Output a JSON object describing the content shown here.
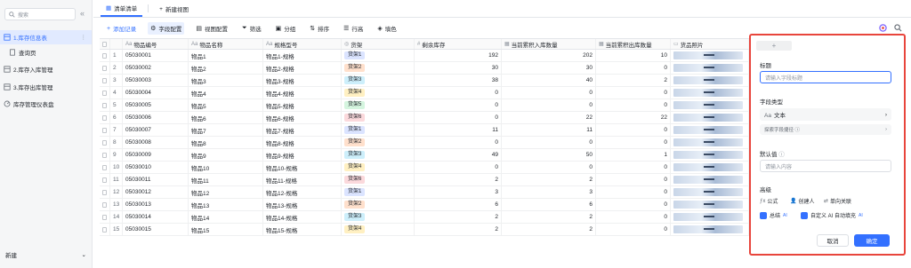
{
  "sidebar": {
    "search_placeholder": "搜索",
    "items": [
      {
        "label": "1.库存信息表"
      },
      {
        "label": "查询页"
      },
      {
        "label": "2.库存入库管理"
      },
      {
        "label": "3.库存出库管理"
      },
      {
        "label": "库存管理仪表盘"
      }
    ],
    "footer_label": "新建"
  },
  "tabs": [
    {
      "label": "清单清单"
    },
    {
      "label": "新建视图"
    }
  ],
  "toolbar": {
    "add": "添加记录",
    "field_config": "字段配置",
    "view_config": "视图配置",
    "filter": "筛选",
    "group": "分组",
    "sort": "排序",
    "row_height": "行高",
    "color": "填色"
  },
  "table": {
    "headers": [
      "物品编号",
      "物品名称",
      "规格型号",
      "货架",
      "剩余库存",
      "当前累积入库数量",
      "当前累积出库数量",
      "货品照片"
    ],
    "header_icons": [
      "Aa",
      "Aa",
      "Aa",
      "◎",
      "#",
      "▦",
      "▦",
      "▭"
    ],
    "rows": [
      {
        "idx": "1",
        "code": "05030001",
        "name": "物品1",
        "spec": "物品1-规格",
        "shelf": "货架1",
        "stock": "192",
        "in": "202",
        "out": "10"
      },
      {
        "idx": "2",
        "code": "05030002",
        "name": "物品2",
        "spec": "物品2-规格",
        "shelf": "货架2",
        "stock": "30",
        "in": "30",
        "out": "0"
      },
      {
        "idx": "3",
        "code": "05030003",
        "name": "物品3",
        "spec": "物品3-规格",
        "shelf": "货架3",
        "stock": "38",
        "in": "40",
        "out": "2"
      },
      {
        "idx": "4",
        "code": "05030004",
        "name": "物品4",
        "spec": "物品4-规格",
        "shelf": "货架4",
        "stock": "0",
        "in": "0",
        "out": "0"
      },
      {
        "idx": "5",
        "code": "05030005",
        "name": "物品5",
        "spec": "物品5-规格",
        "shelf": "货架5",
        "stock": "0",
        "in": "0",
        "out": "0"
      },
      {
        "idx": "6",
        "code": "05030006",
        "name": "物品6",
        "spec": "物品6-规格",
        "shelf": "货架6",
        "stock": "0",
        "in": "22",
        "out": "22"
      },
      {
        "idx": "7",
        "code": "05030007",
        "name": "物品7",
        "spec": "物品7-规格",
        "shelf": "货架1",
        "stock": "11",
        "in": "11",
        "out": "0"
      },
      {
        "idx": "8",
        "code": "05030008",
        "name": "物品8",
        "spec": "物品8-规格",
        "shelf": "货架2",
        "stock": "0",
        "in": "0",
        "out": "0"
      },
      {
        "idx": "9",
        "code": "05030009",
        "name": "物品9",
        "spec": "物品9-规格",
        "shelf": "货架3",
        "stock": "49",
        "in": "50",
        "out": "1"
      },
      {
        "idx": "10",
        "code": "05030010",
        "name": "物品10",
        "spec": "物品10-规格",
        "shelf": "货架4",
        "stock": "0",
        "in": "0",
        "out": "0"
      },
      {
        "idx": "11",
        "code": "05030011",
        "name": "物品11",
        "spec": "物品11-规格",
        "shelf": "货架6",
        "stock": "2",
        "in": "2",
        "out": "0"
      },
      {
        "idx": "12",
        "code": "05030012",
        "name": "物品12",
        "spec": "物品12-规格",
        "shelf": "货架1",
        "stock": "3",
        "in": "3",
        "out": "0"
      },
      {
        "idx": "13",
        "code": "05030013",
        "name": "物品13",
        "spec": "物品13-规格",
        "shelf": "货架2",
        "stock": "6",
        "in": "6",
        "out": "0"
      },
      {
        "idx": "14",
        "code": "05030014",
        "name": "物品14",
        "spec": "物品14-规格",
        "shelf": "货架3",
        "stock": "2",
        "in": "2",
        "out": "0"
      },
      {
        "idx": "15",
        "code": "05030015",
        "name": "物品15",
        "spec": "物品15-规格",
        "shelf": "货架4",
        "stock": "2",
        "in": "2",
        "out": "0"
      }
    ]
  },
  "shelf_colors": {
    "货架1": "#dbe4ff",
    "货架2": "#ffe0cc",
    "货架3": "#cdeffb",
    "货架4": "#fff0c2",
    "货架5": "#d5f5df",
    "货架6": "#fbd9dc"
  },
  "panel": {
    "title_label": "标题",
    "title_placeholder": "请输入字段标题",
    "type_label": "字段类型",
    "type_value": "文本",
    "type_icon": "Aa",
    "explore_label": "探索字段捷径",
    "default_label": "默认值",
    "default_placeholder": "请输入内容",
    "advanced_label": "高级",
    "chip_formula": "公式",
    "chip_creator": "创建人",
    "chip_lookup": "单向关联",
    "toggle_summary": "总结",
    "toggle_ai": "自定义 AI 自动填充",
    "ai_badge": "AI",
    "cancel": "取消",
    "confirm": "确定"
  },
  "colors": {
    "accent": "#3370ff",
    "panel_border": "#e8453c"
  }
}
